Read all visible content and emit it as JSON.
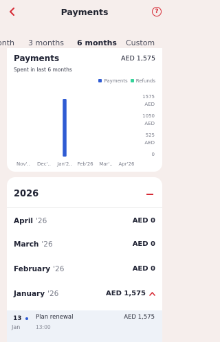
{
  "header": {
    "title": "Payments",
    "back_icon": "chevron-left-icon",
    "help_label": "?"
  },
  "tabs": [
    {
      "label": "onth",
      "active": false
    },
    {
      "label": "3 months",
      "active": false
    },
    {
      "label": "6 months",
      "active": true
    },
    {
      "label": "Custom",
      "active": false
    }
  ],
  "summary": {
    "title": "Payments",
    "total": "AED 1,575",
    "subtitle": "Spent in last 6 months",
    "legend": [
      {
        "label": "Payments",
        "color": "#2f5bd3"
      },
      {
        "label": "Refunds",
        "color": "#34d399"
      }
    ]
  },
  "chart_data": {
    "type": "bar",
    "categories": [
      "Nov'..",
      "Dec'..",
      "Jan'2..",
      "Feb'26",
      "Mar'..",
      "Apr'26"
    ],
    "series": [
      {
        "name": "Payments",
        "color": "#2f5bd3",
        "values": [
          0,
          0,
          1575,
          0,
          0,
          0
        ]
      },
      {
        "name": "Refunds",
        "color": "#34d399",
        "values": [
          0,
          0,
          0,
          0,
          0,
          0
        ]
      }
    ],
    "y_ticks": [
      {
        "value": 1575,
        "label": "1575",
        "unit": "AED"
      },
      {
        "value": 1050,
        "label": "1050",
        "unit": "AED"
      },
      {
        "value": 525,
        "label": "525",
        "unit": "AED"
      },
      {
        "value": 0,
        "label": "0",
        "unit": ""
      }
    ],
    "ylim": [
      0,
      1575
    ]
  },
  "year_section": {
    "year": "2026",
    "months": [
      {
        "name": "April",
        "year": "'26",
        "amount": "AED 0",
        "expanded": false
      },
      {
        "name": "March",
        "year": "'26",
        "amount": "AED 0",
        "expanded": false
      },
      {
        "name": "February",
        "year": "'26",
        "amount": "AED 0",
        "expanded": false
      },
      {
        "name": "January",
        "year": "'26",
        "amount": "AED 1,575",
        "expanded": true
      }
    ],
    "transactions": [
      {
        "day": "13",
        "month": "Jan",
        "name": "Plan renewal",
        "time": "13:00",
        "amount": "AED 1,575"
      }
    ]
  }
}
